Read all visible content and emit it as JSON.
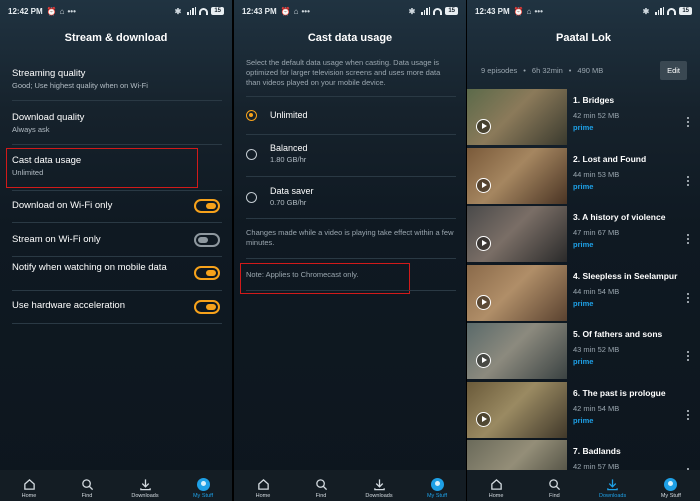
{
  "screen1": {
    "status": {
      "time": "12:42 PM",
      "battery": "15"
    },
    "title": "Stream & download",
    "items": [
      {
        "label": "Streaming quality",
        "sub": "Good; Use highest quality when on Wi-Fi"
      },
      {
        "label": "Download quality",
        "sub": "Always ask"
      },
      {
        "label": "Cast data usage",
        "sub": "Unlimited"
      }
    ],
    "toggles": [
      {
        "label": "Download on Wi-Fi only",
        "on": true
      },
      {
        "label": "Stream on Wi-Fi only",
        "on": false
      },
      {
        "label": "Notify when watching on mobile data",
        "on": true
      },
      {
        "label": "Use hardware acceleration",
        "on": true
      }
    ]
  },
  "screen2": {
    "status": {
      "time": "12:43 PM",
      "battery": "15"
    },
    "title": "Cast data usage",
    "description": "Select the default data usage when casting. Data usage is optimized for larger television screens and uses more data than videos played on your mobile device.",
    "options": [
      {
        "label": "Unlimited",
        "sub": "",
        "selected": true
      },
      {
        "label": "Balanced",
        "sub": "1.80 GB/hr",
        "selected": false
      },
      {
        "label": "Data saver",
        "sub": "0.70 GB/hr",
        "selected": false
      }
    ],
    "footer": "Changes made while a video is playing take effect within a few minutes.",
    "note": "Note: Applies to Chromecast only."
  },
  "screen3": {
    "status": {
      "time": "12:43 PM",
      "battery": "15"
    },
    "title": "Paatal Lok",
    "meta": {
      "episodes": "9 episodes",
      "duration": "6h 32min",
      "size": "490 MB"
    },
    "edit_label": "Edit",
    "prime_label": "prime",
    "episodes": [
      {
        "title": "1. Bridges",
        "info": "42 min   52 MB",
        "palette": [
          "#5b6a4a",
          "#8b7a5a",
          "#3a3a2e"
        ]
      },
      {
        "title": "2. Lost and Found",
        "info": "44 min   53 MB",
        "palette": [
          "#7a5a3a",
          "#a58660",
          "#4a3424"
        ]
      },
      {
        "title": "3. A history of violence",
        "info": "47 min   67 MB",
        "palette": [
          "#4a4a4a",
          "#7a6e66",
          "#2a2a2a"
        ]
      },
      {
        "title": "4. Sleepless in Seelampur",
        "info": "44 min   54 MB",
        "palette": [
          "#8a6a4a",
          "#b08e68",
          "#5a4230"
        ]
      },
      {
        "title": "5. Of fathers and sons",
        "info": "43 min   52 MB",
        "palette": [
          "#5a6a6a",
          "#8c8a7e",
          "#3a4242"
        ]
      },
      {
        "title": "6. The past is prologue",
        "info": "42 min   54 MB",
        "palette": [
          "#6a5a3a",
          "#9a8a62",
          "#40382a"
        ]
      },
      {
        "title": "7. Badlands",
        "info": "42 min   57 MB",
        "palette": [
          "#6a6a5a",
          "#948e78",
          "#3e3e34"
        ]
      }
    ]
  },
  "nav": {
    "items": [
      "Home",
      "Find",
      "Downloads",
      "My Stuff"
    ],
    "active_screens": [
      "My Stuff",
      "My Stuff",
      "Downloads"
    ]
  },
  "colors": {
    "accent": "#f7a21b",
    "prime": "#1ea0e6",
    "highlight": "#d11a1a"
  }
}
